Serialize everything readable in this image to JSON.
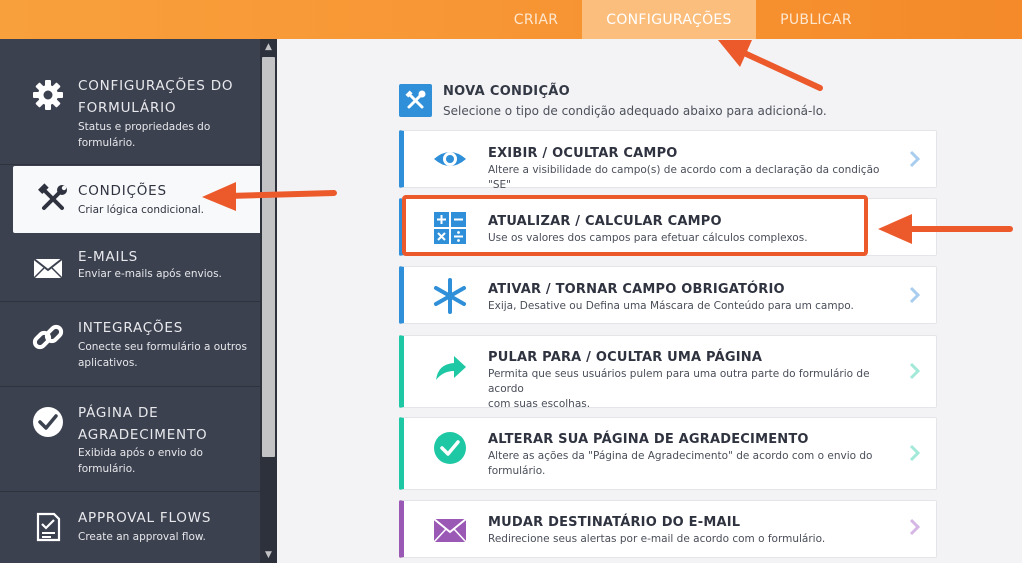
{
  "topbar": {
    "tabs": [
      {
        "label": "CRIAR",
        "active": false
      },
      {
        "label": "CONFIGURAÇÕES",
        "active": true
      },
      {
        "label": "PUBLICAR",
        "active": false
      }
    ]
  },
  "sidebar": {
    "items": [
      {
        "title_line1": "CONFIGURAÇÕES DO",
        "title_line2": "FORMULÁRIO",
        "sub_line1": "Status e propriedades do",
        "sub_line2": "formulário.",
        "icon": "gear-icon"
      },
      {
        "title_line1": "CONDIÇÕES",
        "sub_line1": "Criar lógica condicional.",
        "icon": "tools-icon",
        "active": true
      },
      {
        "title_line1": "E-MAILS",
        "sub_line1": "Enviar e-mails após envios.",
        "icon": "envelope-icon"
      },
      {
        "title_line1": "INTEGRAÇÕES",
        "sub_line1": "Conecte seu formulário a outros",
        "sub_line2": "aplicativos.",
        "icon": "link-icon"
      },
      {
        "title_line1": "PÁGINA DE",
        "title_line2": "AGRADECIMENTO",
        "sub_line1": "Exibida após o envio do",
        "sub_line2": "formulário.",
        "icon": "check-circle-icon"
      },
      {
        "title_line1": "APPROVAL FLOWS",
        "sub_line1": "Create an approval flow.",
        "icon": "approval-doc-icon"
      }
    ]
  },
  "main": {
    "title": "NOVA CONDIÇÃO",
    "subtitle": "Selecione o tipo de condição adequado abaixo para adicioná-lo.",
    "cards": [
      {
        "title": "EXIBIR / OCULTAR CAMPO",
        "sub_line1": "Altere a visibilidade do campo(s) de acordo com a declaração da condição \"SE\"",
        "icon": "eye-icon",
        "color": "#2f8fd8"
      },
      {
        "title": "ATUALIZAR / CALCULAR CAMPO",
        "sub_line1": "Use os valores dos campos para efetuar cálculos complexos.",
        "icon": "calculator-icon",
        "color": "#2f8fd8"
      },
      {
        "title": "ATIVAR / TORNAR CAMPO OBRIGATÓRIO",
        "sub_line1": "Exija, Desative ou Defina uma Máscara de Conteúdo para um campo.",
        "icon": "asterisk-icon",
        "color": "#2f8fd8"
      },
      {
        "title": "PULAR PARA / OCULTAR UMA PÁGINA",
        "sub_line1": "Permita que seus usuários pulem para uma outra parte do formulário de acordo",
        "sub_line2": "com suas escolhas.",
        "icon": "share-arrow-icon",
        "color": "#1fc8a4"
      },
      {
        "title": "ALTERAR SUA PÁGINA DE AGRADECIMENTO",
        "sub_line1": "Altere as ações da \"Página de Agradecimento\" de acordo com o envio do",
        "sub_line2": "formulário.",
        "icon": "check-circle-icon",
        "color": "#1fc8a4"
      },
      {
        "title": "MUDAR DESTINATÁRIO DO E-MAIL",
        "sub_line1": "Redirecione seus alertas por e-mail de acordo com o formulário.",
        "icon": "envelope-icon",
        "color": "#9b59b6"
      }
    ]
  },
  "colors": {
    "topbar": "#f79332",
    "sidebar": "#3c4150",
    "annotation": "#ec5a2c",
    "blue": "#2f8fd8",
    "teal": "#1fc8a4",
    "purple": "#9b59b6"
  }
}
